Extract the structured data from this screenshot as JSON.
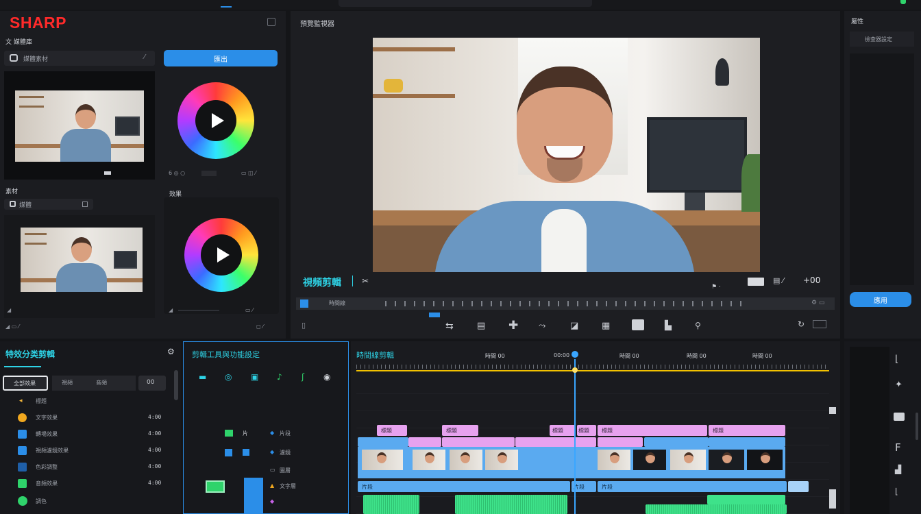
{
  "brand": {
    "logo": "SHARP"
  },
  "left": {
    "section1_title": "文 媒體庫",
    "asset1_label": "媒體素材",
    "apply_button": "匯出",
    "section2_title": "素材",
    "asset2_label": "媒體",
    "effects_title": "效果"
  },
  "viewer": {
    "title": "預覽監視器",
    "label": "視頻剪輯",
    "timecode": "+00",
    "scrub_label": "時間線"
  },
  "right": {
    "title": "屬性",
    "subtitle": "檢查器設定",
    "apply_button": "應用"
  },
  "effects_panel": {
    "title": "特效分类剪輯",
    "tabs": [
      "全部效果",
      "視頻",
      "音頻"
    ],
    "tab_value": "00",
    "items": [
      {
        "label": "標題",
        "value": ""
      },
      {
        "label": "文字效果",
        "value": "4:00"
      },
      {
        "label": "轉場效果",
        "value": "4:00"
      },
      {
        "label": "視頻濾鏡效果",
        "value": "4:00"
      },
      {
        "label": "色彩調整",
        "value": "4:00"
      },
      {
        "label": "音頻效果",
        "value": "4:00"
      },
      {
        "label": "調色",
        "value": ""
      }
    ]
  },
  "tools_panel": {
    "title": "剪輯工具與功能設定",
    "rows": [
      {
        "a": "片",
        "b": "片段"
      },
      {
        "a": "",
        "b": "濾鏡"
      },
      {
        "a": "",
        "b": "圖層"
      },
      {
        "a": "",
        "b": "文字層"
      }
    ]
  },
  "timeline": {
    "title": "時間線剪輯",
    "ruler": [
      "時間 00",
      "00:00",
      "時間 00",
      "時間 00",
      "時間 00"
    ],
    "pink_labels": [
      "標題",
      "標題",
      "標題",
      "標題",
      "標題",
      "標題"
    ],
    "blue_labels": [
      "片段",
      "片段",
      "片段"
    ]
  },
  "colors": {
    "accent": "#2b8ee8",
    "cyan": "#2ed3e6",
    "pink_track": "#e7a2ef",
    "blue_track": "#5aaaf0",
    "green_track": "#3ee28a",
    "playhead": "#3aa6ff",
    "ruler_line": "#f2c200",
    "logo": "#ff2a2a"
  }
}
